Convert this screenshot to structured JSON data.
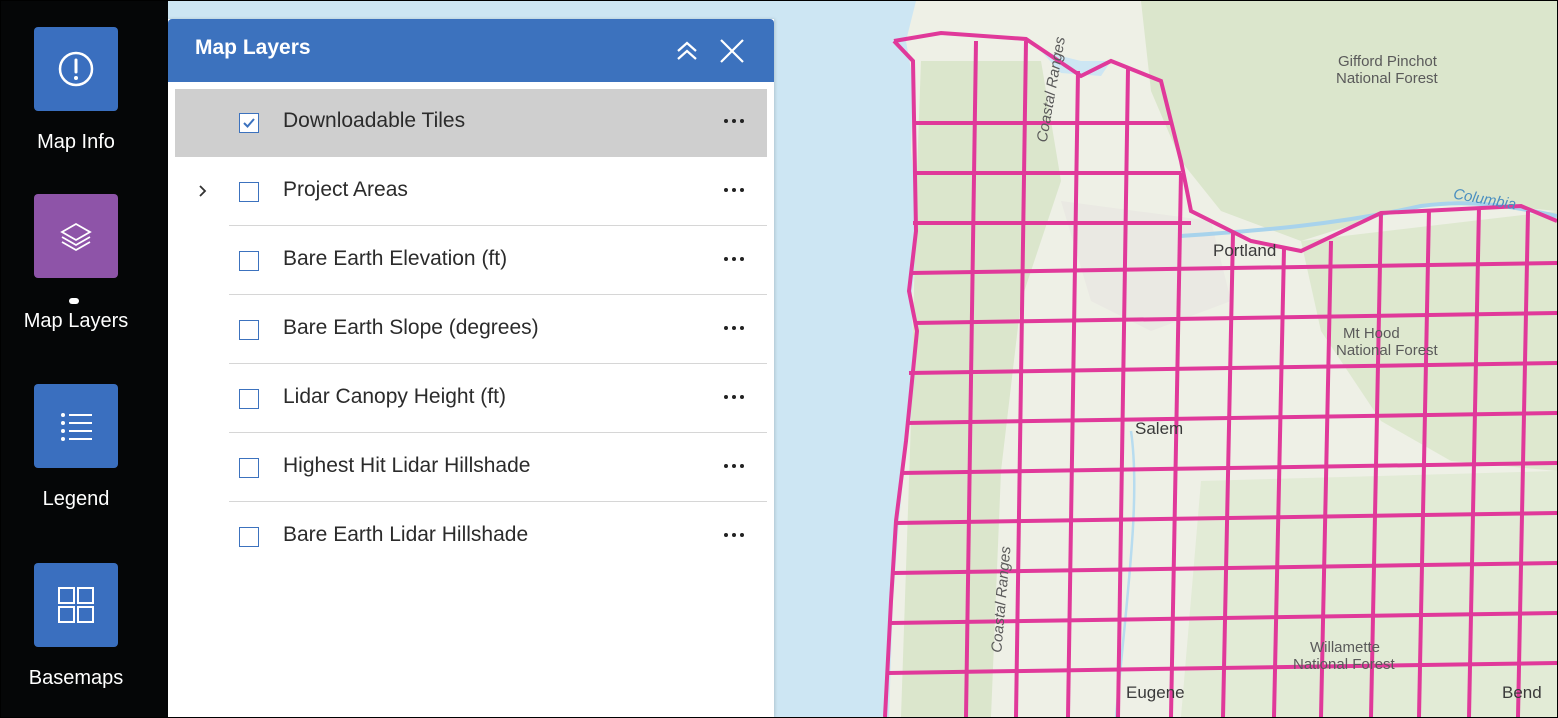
{
  "toolbar": {
    "items": [
      {
        "label": "Map Info",
        "icon": "info-icon"
      },
      {
        "label": "Map Layers",
        "icon": "layers-icon",
        "active": true
      },
      {
        "label": "Legend",
        "icon": "list-icon"
      },
      {
        "label": "Basemaps",
        "icon": "grid-icon"
      }
    ],
    "colors": {
      "button": "#3a6fbf",
      "active_button": "#8e54a8",
      "background": "#050607"
    }
  },
  "panel": {
    "title": "Map Layers",
    "header_color": "#3c72be",
    "layers": [
      {
        "label": "Downloadable Tiles",
        "checked": true,
        "selected": true
      },
      {
        "label": "Project Areas",
        "checked": false,
        "expandable": true
      },
      {
        "label": "Bare Earth Elevation (ft)",
        "checked": false
      },
      {
        "label": "Bare Earth Slope (degrees)",
        "checked": false
      },
      {
        "label": "Lidar Canopy Height (ft)",
        "checked": false
      },
      {
        "label": "Highest Hit Lidar Hillshade",
        "checked": false
      },
      {
        "label": "Bare Earth Lidar Hillshade",
        "checked": false
      }
    ]
  },
  "map": {
    "tile_color": "#e0399a",
    "water_color": "#cde6f3",
    "labels": {
      "gifford_1": "Gifford Pinchot",
      "gifford_2": "National Forest",
      "columbia": "Columbia",
      "portland": "Portland",
      "mthood_1": "Mt Hood",
      "mthood_2": "National Forest",
      "salem": "Salem",
      "willamette_1": "Willamette",
      "willamette_2": "National Forest",
      "eugene": "Eugene",
      "bend": "Bend",
      "coastal_ranges": "Coastal Ranges"
    }
  }
}
